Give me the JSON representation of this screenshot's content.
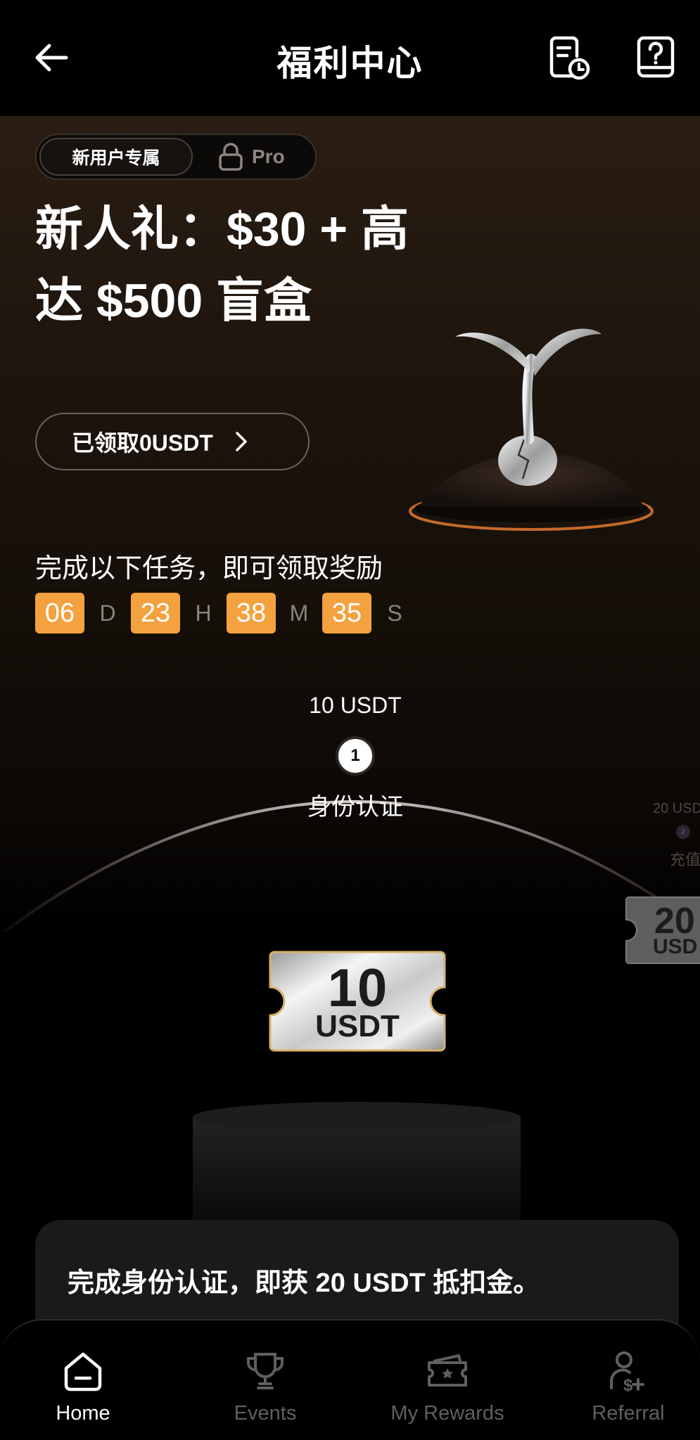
{
  "header": {
    "title": "福利中心"
  },
  "segmented": {
    "active_label": "新用户专属",
    "locked_label": "Pro"
  },
  "hero": {
    "title": "新人礼：$30 + 高达 $500 盲盒",
    "claimed_label": "已领取0USDT"
  },
  "tasks": {
    "title": "完成以下任务，即可领取奖励",
    "countdown": {
      "days": "06",
      "days_unit": "D",
      "hours": "23",
      "hours_unit": "H",
      "minutes": "38",
      "minutes_unit": "M",
      "seconds": "35",
      "seconds_unit": "S"
    },
    "steps": [
      {
        "number": "1",
        "reward": "10 USDT",
        "label": "身份认证"
      },
      {
        "number": "2",
        "reward": "20 USD",
        "label": "充值"
      }
    ]
  },
  "coupons": {
    "main": {
      "amount": "10",
      "unit": "USDT"
    },
    "side": {
      "amount": "20",
      "unit": "USD"
    }
  },
  "info_card": {
    "text": "完成身份认证，即获 20 USDT 抵扣金。"
  },
  "bottom_nav": {
    "items": [
      {
        "label": "Home",
        "icon": "home-icon",
        "active": true
      },
      {
        "label": "Events",
        "icon": "trophy-icon",
        "active": false
      },
      {
        "label": "My Rewards",
        "icon": "ticket-icon",
        "active": false
      },
      {
        "label": "Referral",
        "icon": "user-plus-dollar-icon",
        "active": false
      }
    ]
  },
  "colors": {
    "accent_orange": "#f4a13f",
    "background": "#000000",
    "hero_brown": "#2a1d12",
    "card": "#1a1a1a"
  }
}
